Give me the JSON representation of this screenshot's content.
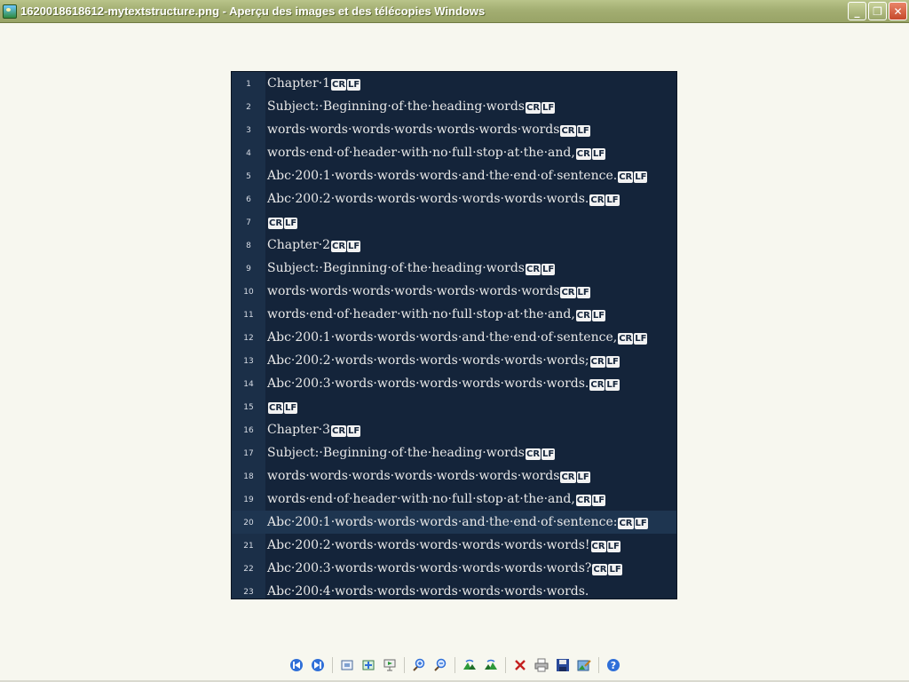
{
  "window": {
    "title": "1620018618612-mytextstructure.png - Aperçu des images et des télécopies Windows",
    "buttons": {
      "minimize": "_",
      "maximize": "❐",
      "close": "✕"
    }
  },
  "eol_marker": {
    "cr": "CR",
    "lf": "LF"
  },
  "editor": {
    "current_line": 20,
    "bookmark_line": 5,
    "lines": [
      {
        "n": "1",
        "text": "Chapter·1",
        "eol": true
      },
      {
        "n": "2",
        "text": "Subject:·Beginning·of·the·heading·words",
        "eol": true
      },
      {
        "n": "3",
        "text": "words·words·words·words·words·words·words",
        "eol": true
      },
      {
        "n": "4",
        "text": "words·end·of·header·with·no·full·stop·at·the·and,",
        "eol": true
      },
      {
        "n": "5",
        "text": "Abc·200:1·words·words·words·and·the·end·of·sentence.",
        "eol": true
      },
      {
        "n": "6",
        "text": "Abc·200:2·words·words·words·words·words·words.",
        "eol": true
      },
      {
        "n": "7",
        "text": "",
        "eol": true
      },
      {
        "n": "8",
        "text": "Chapter·2",
        "eol": true
      },
      {
        "n": "9",
        "text": "Subject:·Beginning·of·the·heading·words",
        "eol": true
      },
      {
        "n": "10",
        "text": "words·words·words·words·words·words·words",
        "eol": true
      },
      {
        "n": "11",
        "text": "words·end·of·header·with·no·full·stop·at·the·and,",
        "eol": true
      },
      {
        "n": "12",
        "text": "Abc·200:1·words·words·words·and·the·end·of·sentence,",
        "eol": true
      },
      {
        "n": "13",
        "text": "Abc·200:2·words·words·words·words·words·words;",
        "eol": true
      },
      {
        "n": "14",
        "text": "Abc·200:3·words·words·words·words·words·words.",
        "eol": true
      },
      {
        "n": "15",
        "text": "",
        "eol": true
      },
      {
        "n": "16",
        "text": "Chapter·3",
        "eol": true
      },
      {
        "n": "17",
        "text": "Subject:·Beginning·of·the·heading·words",
        "eol": true
      },
      {
        "n": "18",
        "text": "words·words·words·words·words·words·words",
        "eol": true
      },
      {
        "n": "19",
        "text": "words·end·of·header·with·no·full·stop·at·the·and,",
        "eol": true
      },
      {
        "n": "20",
        "text": "Abc·200:1·words·words·words·and·the·end·of·sentence:",
        "eol": true
      },
      {
        "n": "21",
        "text": "Abc·200:2·words·words·words·words·words·words!",
        "eol": true
      },
      {
        "n": "22",
        "text": "Abc·200:3·words·words·words·words·words·words?",
        "eol": true
      },
      {
        "n": "23",
        "text": "Abc·200:4·words·words·words·words·words·words.",
        "eol": false
      }
    ]
  },
  "toolbar": {
    "items": [
      "previous-image-icon",
      "next-image-icon",
      "best-fit-icon",
      "actual-size-icon",
      "slideshow-icon",
      "zoom-in-icon",
      "zoom-out-icon",
      "rotate-clockwise-icon",
      "rotate-counterclockwise-icon",
      "delete-icon",
      "print-icon",
      "save-icon",
      "edit-icon",
      "help-icon"
    ],
    "colors": {
      "nav_blue": "#2f6fd8",
      "rotate_green": "#2e9a3a",
      "delete_red": "#c42020"
    }
  }
}
